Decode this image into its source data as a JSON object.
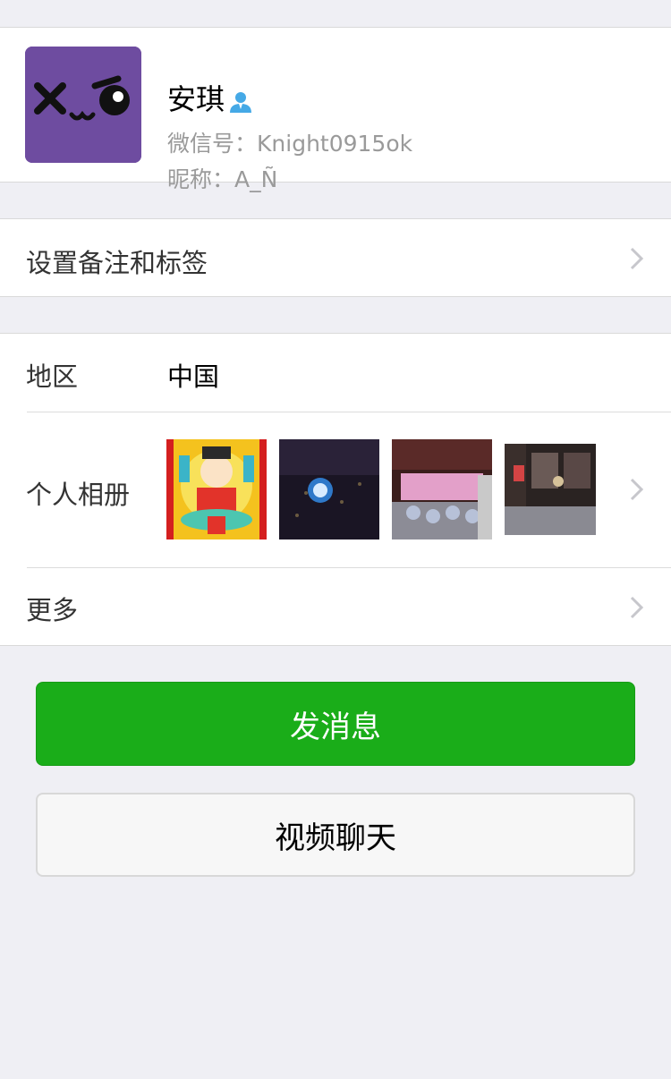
{
  "profile": {
    "name": "安琪",
    "wechat_id_label": "微信号：",
    "wechat_id": "Knight0915ok",
    "nickname_label": "昵称：",
    "nickname": "A_Ñ",
    "avatar_color": "#6e4ca0",
    "gender_icon": "person-icon",
    "gender_icon_color": "#45a9e6"
  },
  "remark_row": {
    "label": "设置备注和标签",
    "icon": "chevron-right-icon"
  },
  "details": {
    "region": {
      "label": "地区",
      "value": "中国"
    },
    "album": {
      "label": "个人相册",
      "icon": "chevron-right-icon",
      "thumbnails": [
        "album-photo-1",
        "album-photo-2",
        "album-photo-3",
        "album-photo-4"
      ]
    },
    "more": {
      "label": "更多",
      "icon": "chevron-right-icon"
    }
  },
  "actions": {
    "send_message": "发消息",
    "video_chat": "视频聊天",
    "send_color": "#1aad19"
  }
}
